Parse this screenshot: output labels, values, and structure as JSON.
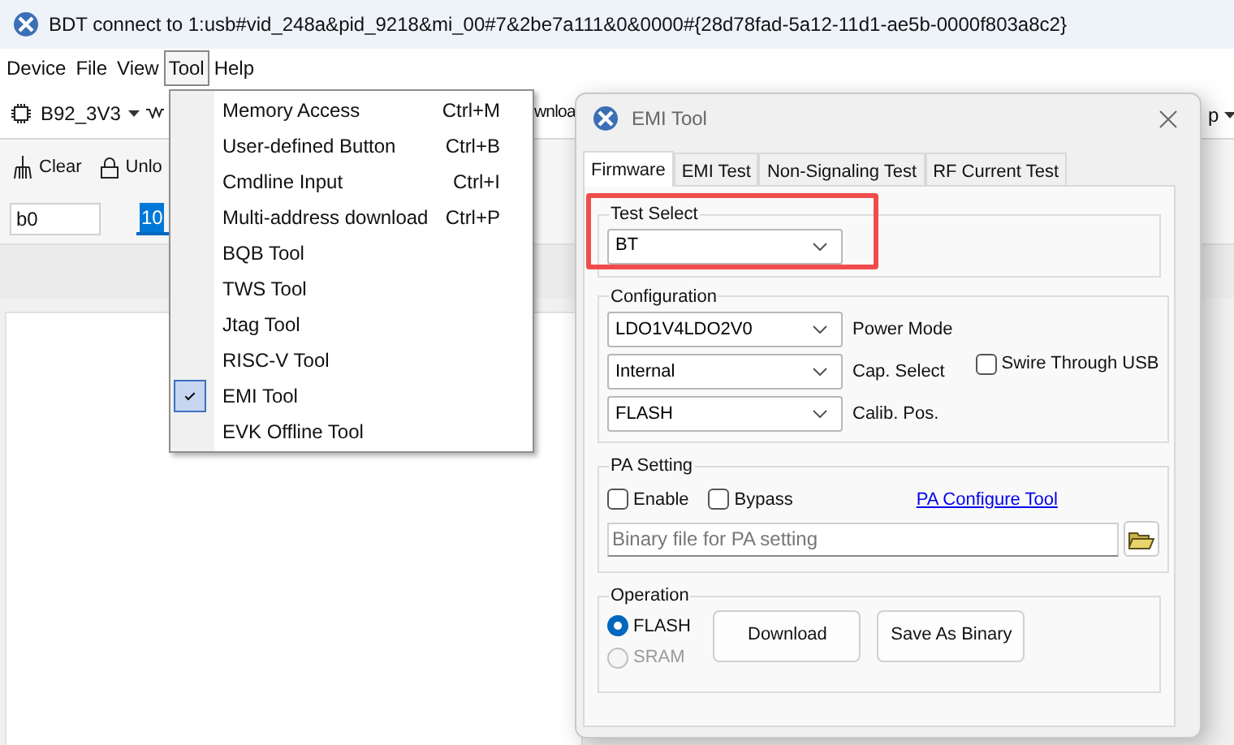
{
  "window": {
    "title": "BDT connect to 1:usb#vid_248a&pid_9218&mi_00#7&2be7a111&0&0000#{28d78fad-5a12-11d1-ae5b-0000f803a8c2}"
  },
  "menu_bar": [
    {
      "label": "Device",
      "selected": false
    },
    {
      "label": "File",
      "selected": false
    },
    {
      "label": "View",
      "selected": false
    },
    {
      "label": "Tool",
      "selected": true
    },
    {
      "label": "Help",
      "selected": false
    }
  ],
  "toolbar": {
    "device": "B92_3V3",
    "partial_button": "wnloa",
    "right_partial": "p"
  },
  "actions": [
    "Clear",
    "Unlo"
  ],
  "fields": [
    {
      "value": "b0",
      "highlighted": false
    },
    {
      "value": "10",
      "highlighted": true
    }
  ],
  "tool_menu": [
    {
      "label": "Memory Access",
      "shortcut": "Ctrl+M",
      "checked": false
    },
    {
      "label": "User-defined Button",
      "shortcut": "Ctrl+B",
      "checked": false
    },
    {
      "label": "Cmdline Input",
      "shortcut": "Ctrl+I",
      "checked": false
    },
    {
      "label": "Multi-address download",
      "shortcut": "Ctrl+P",
      "checked": false
    },
    {
      "label": "BQB Tool",
      "checked": false
    },
    {
      "label": "TWS Tool",
      "checked": false
    },
    {
      "label": "Jtag Tool",
      "checked": false
    },
    {
      "label": "RISC-V Tool",
      "checked": false
    },
    {
      "label": "EMI Tool",
      "checked": true
    },
    {
      "label": "EVK Offline Tool",
      "checked": false
    }
  ],
  "dialog": {
    "title": "EMI Tool",
    "tabs": [
      {
        "label": "Firmware",
        "selected": true
      },
      {
        "label": "EMI Test",
        "selected": false
      },
      {
        "label": "Non-Signaling Test",
        "selected": false
      },
      {
        "label": "RF Current Test",
        "selected": false
      }
    ],
    "test_select": {
      "title": "Test Select",
      "value": "BT",
      "highlight": true
    },
    "configuration": {
      "title": "Configuration",
      "rows": [
        {
          "value": "LDO1V4LDO2V0",
          "label": "Power Mode"
        },
        {
          "value": "Internal",
          "label": "Cap. Select"
        },
        {
          "value": "FLASH",
          "label": "Calib. Pos."
        }
      ],
      "swire": {
        "label": "Swire Through USB",
        "checked": false
      }
    },
    "pa_setting": {
      "title": "PA Setting",
      "options": [
        {
          "label": "Enable",
          "checked": false
        },
        {
          "label": "Bypass",
          "checked": false
        }
      ],
      "link": "PA Configure Tool",
      "file": {
        "placeholder": "Binary file for PA setting"
      }
    },
    "operation": {
      "title": "Operation",
      "targets": [
        {
          "label": "FLASH",
          "selected": true,
          "disabled": false
        },
        {
          "label": "SRAM",
          "selected": false,
          "disabled": true
        }
      ],
      "buttons": [
        "Download",
        "Save As Binary"
      ]
    }
  }
}
